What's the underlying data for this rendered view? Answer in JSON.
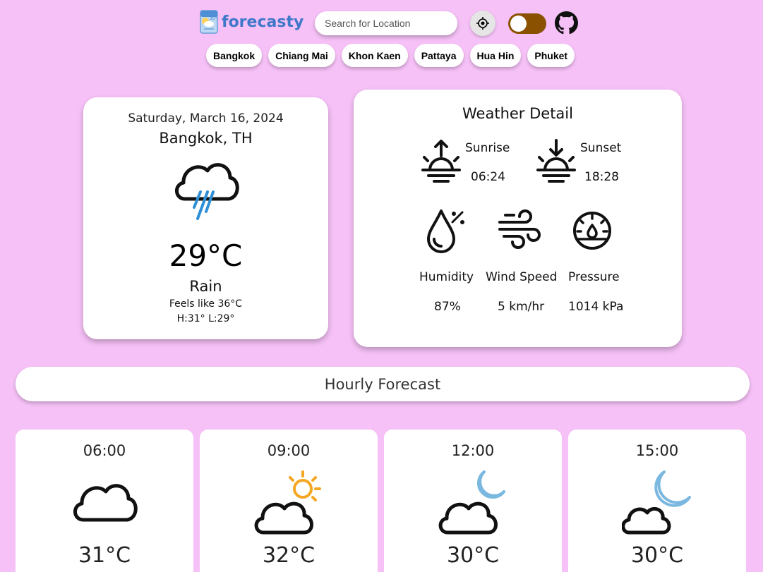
{
  "header": {
    "logo_text": "forecasty",
    "search_placeholder": "Search for Location",
    "locate_icon": "crosshair-icon",
    "theme_toggle_color": "#8a5200",
    "github_icon": "github-icon"
  },
  "cities": [
    "Bangkok",
    "Chiang Mai",
    "Khon Kaen",
    "Pattaya",
    "Hua Hin",
    "Phuket"
  ],
  "current": {
    "date": "Saturday, March 16, 2024",
    "location": "Bangkok, TH",
    "icon": "rain-cloud-icon",
    "temperature": "29°C",
    "condition": "Rain",
    "feels_like": "Feels like 36°C",
    "high_low": "H:31° L:29°"
  },
  "details": {
    "title": "Weather Detail",
    "sunrise_label": "Sunrise",
    "sunrise_time": "06:24",
    "sunset_label": "Sunset",
    "sunset_time": "18:28",
    "humidity_label": "Humidity",
    "humidity_value": "87%",
    "wind_label": "Wind Speed",
    "wind_value": "5 km/hr",
    "pressure_label": "Pressure",
    "pressure_value": "1014 kPa"
  },
  "hourly": {
    "title": "Hourly Forecast",
    "items": [
      {
        "time": "06:00",
        "temp": "31°C",
        "icon": "cloud-icon"
      },
      {
        "time": "09:00",
        "temp": "32°C",
        "icon": "sun-cloud-icon"
      },
      {
        "time": "12:00",
        "temp": "30°C",
        "icon": "moon-cloud-icon"
      },
      {
        "time": "15:00",
        "temp": "30°C",
        "icon": "moon-cloud-icon"
      }
    ]
  },
  "colors": {
    "background": "#f6c1f7",
    "logo": "#3f78c9",
    "rain": "#2f8fd6",
    "sun": "#f5a623",
    "moon": "#7ab8e0"
  }
}
